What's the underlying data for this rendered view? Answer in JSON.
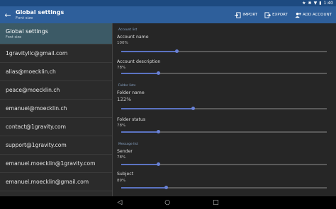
{
  "statusbar": {
    "time": "1:40"
  },
  "appbar": {
    "title": "Global settings",
    "subtitle": "Font size",
    "actions": {
      "import": "IMPORT",
      "export": "EXPORT",
      "add_account": "ADD ACCOUNT"
    }
  },
  "list": {
    "selected": {
      "title": "Global settings",
      "subtitle": "Font size"
    },
    "items": [
      "1gravityllc@gmail.com",
      "alias@moecklin.ch",
      "peace@moecklin.ch",
      "emanuel@moecklin.ch",
      "contact@1gravity.com",
      "support@1gravity.com",
      "emanuel.moecklin@1gravity.com",
      "emanuel.moecklin@gmail.com"
    ]
  },
  "panel": {
    "account_list_header": "Account list",
    "account_name": {
      "label": "Account name",
      "value": "100%",
      "fraction": 0.27
    },
    "account_description": {
      "label": "Account description",
      "value": "78%",
      "fraction": 0.18
    },
    "folder_lists_header": "Folder lists",
    "folder_name": {
      "label": "Folder name",
      "value": "122%",
      "fraction": 0.35
    },
    "folder_status": {
      "label": "Folder status",
      "value": "78%",
      "fraction": 0.18
    },
    "message_list_header": "Message list",
    "sender": {
      "label": "Sender",
      "value": "78%",
      "fraction": 0.18
    },
    "subject": {
      "label": "Subject",
      "value": "89%",
      "fraction": 0.22
    }
  }
}
